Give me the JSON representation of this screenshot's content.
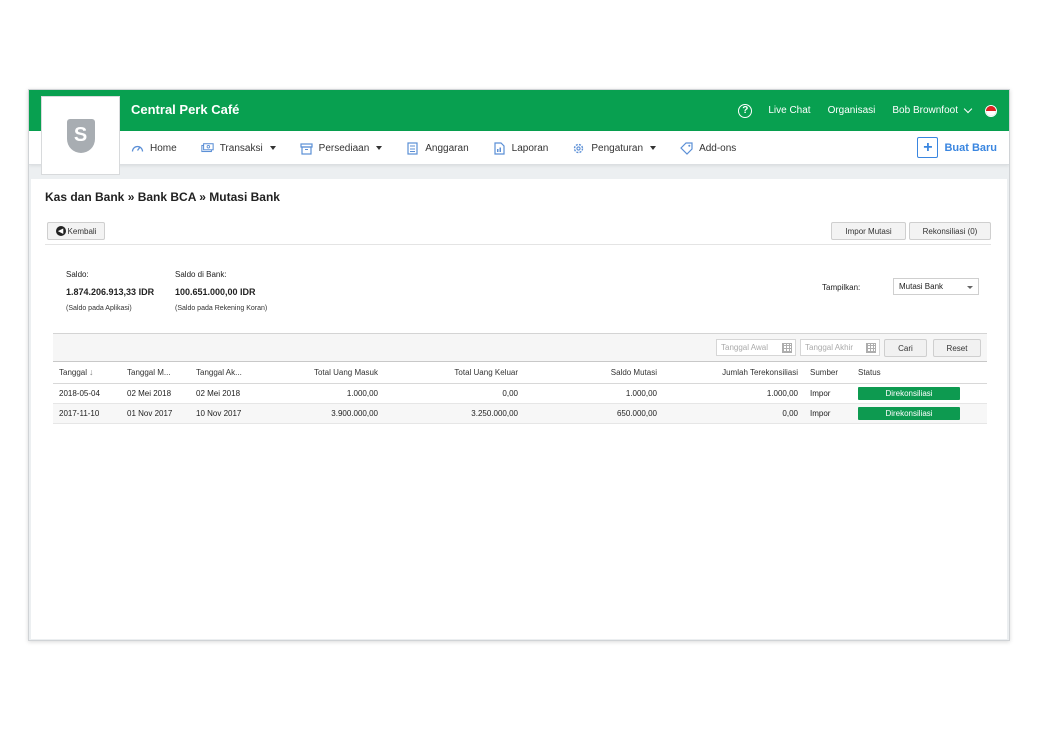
{
  "app": {
    "title": "Central Perk Café",
    "logo_letter": "S"
  },
  "topbar": {
    "help": "?",
    "links": [
      "Live Chat",
      "Organisasi"
    ],
    "user": "Bob Brownfoot"
  },
  "nav": {
    "items": [
      {
        "label": "Home",
        "icon": "dashboard-icon",
        "dropdown": false
      },
      {
        "label": "Transaksi",
        "icon": "money-icon",
        "dropdown": true
      },
      {
        "label": "Persediaan",
        "icon": "box-icon",
        "dropdown": true
      },
      {
        "label": "Anggaran",
        "icon": "calculator-icon",
        "dropdown": false
      },
      {
        "label": "Laporan",
        "icon": "report-icon",
        "dropdown": false
      },
      {
        "label": "Pengaturan",
        "icon": "gear-icon",
        "dropdown": true
      },
      {
        "label": "Add-ons",
        "icon": "tag-icon",
        "dropdown": false
      }
    ],
    "new_button": "Buat Baru"
  },
  "page": {
    "breadcrumb": "Kas dan Bank » Bank BCA » Mutasi Bank",
    "back_button": "Kembali",
    "import_button": "Impor Mutasi",
    "reconcile_button": "Rekonsiliasi (0)"
  },
  "summary": {
    "saldo_label": "Saldo:",
    "saldo_value": "1.874.206.913,33 IDR",
    "saldo_note": "(Saldo pada Aplikasi)",
    "bank_label": "Saldo di Bank:",
    "bank_value": "100.651.000,00 IDR",
    "bank_note": "(Saldo pada Rekening Koran)"
  },
  "view": {
    "label": "Tampilkan:",
    "selected": "Mutasi Bank"
  },
  "filter": {
    "start_placeholder": "Tanggal Awal",
    "end_placeholder": "Tanggal Akhir",
    "search_button": "Cari",
    "reset_button": "Reset"
  },
  "table": {
    "headers": [
      "Tanggal",
      "Tanggal M...",
      "Tanggal Ak...",
      "Total Uang Masuk",
      "Total Uang Keluar",
      "Saldo Mutasi",
      "Jumlah Terekonsiliasi",
      "Sumber",
      "Status"
    ],
    "rows": [
      [
        "2018-05-04",
        "02 Mei 2018",
        "02 Mei 2018",
        "1.000,00",
        "0,00",
        "1.000,00",
        "1.000,00",
        "Impor",
        "Direkonsiliasi"
      ],
      [
        "2017-11-10",
        "01 Nov 2017",
        "10 Nov 2017",
        "3.900.000,00",
        "3.250.000,00",
        "650.000,00",
        "0,00",
        "Impor",
        "Direkonsiliasi"
      ]
    ]
  },
  "colors": {
    "brand_green": "#08a050",
    "accent_blue": "#3a86e0",
    "status_green": "#0d9a50"
  }
}
